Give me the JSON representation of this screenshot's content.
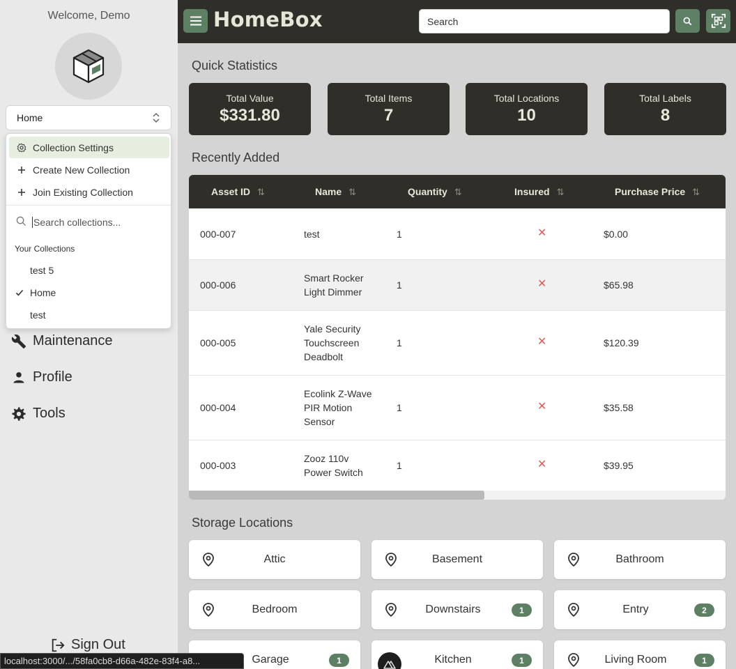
{
  "sidebar": {
    "welcome": "Welcome, Demo",
    "collection_selected": "Home",
    "menu": {
      "settings": "Collection Settings",
      "create": "Create New Collection",
      "join": "Join Existing Collection"
    },
    "search_placeholder": "Search collections...",
    "collections_heading": "Your Collections",
    "collections": [
      "test 5",
      "Home",
      "test"
    ],
    "checked_collection": "Home",
    "nav": {
      "maintenance": "Maintenance",
      "profile": "Profile",
      "tools": "Tools"
    },
    "sign_out": "Sign Out",
    "status_url": "localhost:3000/.../58fa0cb8-d66a-482e-83f4-a8..."
  },
  "header": {
    "logo": "HomeBox",
    "search_placeholder": "Search"
  },
  "stats": {
    "title": "Quick Statistics",
    "items": [
      {
        "label": "Total Value",
        "value": "$331.80"
      },
      {
        "label": "Total Items",
        "value": "7"
      },
      {
        "label": "Total Locations",
        "value": "10"
      },
      {
        "label": "Total Labels",
        "value": "8"
      }
    ]
  },
  "recent": {
    "title": "Recently Added",
    "columns": [
      "Asset ID",
      "Name",
      "Quantity",
      "Insured",
      "Purchase Price"
    ],
    "rows": [
      {
        "asset_id": "000-007",
        "name": [
          "test"
        ],
        "quantity": "1",
        "insured": "✕",
        "price": "$0.00"
      },
      {
        "asset_id": "000-006",
        "name": [
          "Smart Rocker",
          "Light Dimmer"
        ],
        "quantity": "1",
        "insured": "✕",
        "price": "$65.98"
      },
      {
        "asset_id": "000-005",
        "name": [
          "Yale Security",
          "Touchscreen",
          "Deadbolt"
        ],
        "quantity": "1",
        "insured": "✕",
        "price": "$120.39"
      },
      {
        "asset_id": "000-004",
        "name": [
          "Ecolink Z-Wave",
          "PIR Motion",
          "Sensor"
        ],
        "quantity": "1",
        "insured": "✕",
        "price": "$35.58"
      },
      {
        "asset_id": "000-003",
        "name": [
          "Zooz 110v",
          "Power Switch"
        ],
        "quantity": "1",
        "insured": "✕",
        "price": "$39.95"
      }
    ],
    "scroll_fraction": 0.55
  },
  "locations": {
    "title": "Storage Locations",
    "items": [
      {
        "name": "Attic",
        "count": ""
      },
      {
        "name": "Basement",
        "count": ""
      },
      {
        "name": "Bathroom",
        "count": ""
      },
      {
        "name": "Bedroom",
        "count": ""
      },
      {
        "name": "Downstairs",
        "count": "1"
      },
      {
        "name": "Entry",
        "count": "2"
      },
      {
        "name": "Garage",
        "count": "1"
      },
      {
        "name": "Kitchen",
        "count": "1"
      },
      {
        "name": "Living Room",
        "count": "1"
      }
    ]
  },
  "colors": {
    "header_bg": "#2f2e29",
    "accent": "#5d7f64",
    "cross": "#e35a5a"
  }
}
